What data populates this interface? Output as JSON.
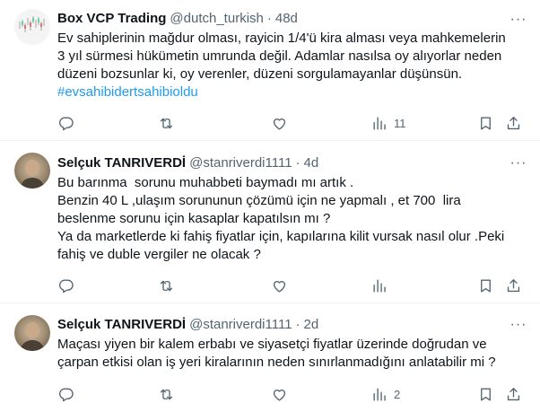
{
  "tweets": [
    {
      "author": "Box VCP Trading",
      "handle": "@dutch_turkish",
      "separator": "·",
      "time": "48d",
      "lines": [
        "Ev sahiplerinin mağdur olması, rayicin 1/4'ü kira alması veya mahkemelerin",
        "3 yıl sürmesi hükümetin umrunda değil. Adamlar nasılsa oy alıyorlar neden",
        "düzeni bozsunlar ki, oy verenler, düzeni sorgulamayanlar düşünsün."
      ],
      "hashtag": "#evsahibidertsahibioldu",
      "views_count": "11"
    },
    {
      "author": "Selçuk TANRIVERDİ",
      "handle": "@stanriverdi1111",
      "separator": "·",
      "time": "4d",
      "lines": [
        "Bu barınma  sorunu muhabbeti baymadı mı artık .",
        "Benzin 40 L ,ulaşım sorununun çözümü için ne yapmalı , et 700  lira",
        "beslenme sorunu için kasaplar kapatılsın mı ?",
        "Ya da marketlerde ki fahiş fiyatlar için, kapılarına kilit vursak nasıl olur .Peki",
        "fahiş ve duble vergiler ne olacak ?"
      ],
      "views_count": ""
    },
    {
      "author": "Selçuk TANRIVERDİ",
      "handle": "@stanriverdi1111",
      "separator": "·",
      "time": "2d",
      "lines": [
        "Maçası yiyen bir kalem erbabı ve siyasetçi fiyatlar üzerinde doğrudan ve",
        "çarpan etkisi olan iş yeri kiralarının neden sınırlanmadığını anlatabilir mi ?"
      ],
      "views_count": "2"
    }
  ],
  "icons": {
    "more": "more-horizontal-icon",
    "reply": "reply-icon",
    "retweet": "retweet-icon",
    "like": "heart-icon",
    "views": "views-chart-icon",
    "bookmark": "bookmark-icon",
    "share": "share-icon"
  },
  "colors": {
    "text": "#0f1419",
    "secondary": "#536471",
    "hashtag": "#1d9bf0",
    "divider": "#eff3f4"
  },
  "more_glyph": "···"
}
